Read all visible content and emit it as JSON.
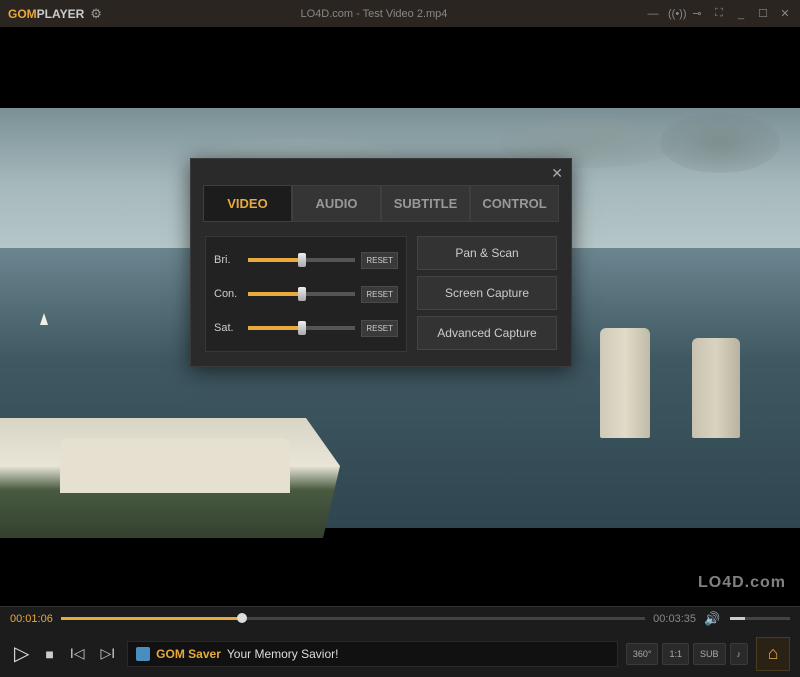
{
  "app": {
    "logo_gom": "GOM",
    "logo_player": "PLAYER",
    "title": "LO4D.com - Test Video 2.mp4"
  },
  "popup": {
    "tabs": [
      "VIDEO",
      "AUDIO",
      "SUBTITLE",
      "CONTROL"
    ],
    "active_tab": 0,
    "sliders": [
      {
        "label": "Bri.",
        "reset": "RESET"
      },
      {
        "label": "Con.",
        "reset": "RESET"
      },
      {
        "label": "Sat.",
        "reset": "RESET"
      }
    ],
    "buttons": [
      "Pan & Scan",
      "Screen Capture",
      "Advanced Capture"
    ]
  },
  "timeline": {
    "current": "00:01:06",
    "total": "00:03:35"
  },
  "ticker": {
    "title": "GOM Saver",
    "message": "Your Memory Savior!"
  },
  "right_buttons": [
    "360°",
    "1:1",
    "SUB",
    "♪"
  ],
  "watermark": "LO4D.com"
}
